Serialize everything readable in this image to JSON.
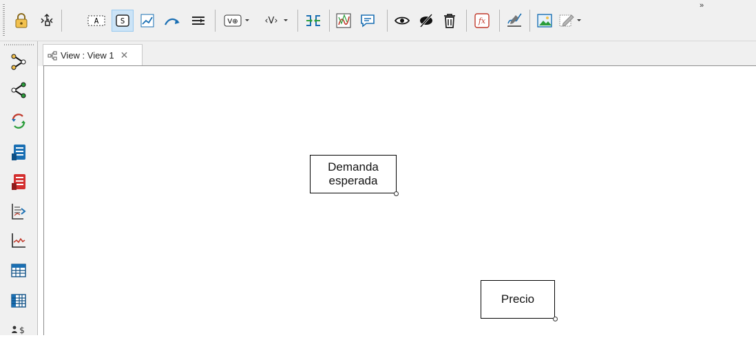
{
  "toolbar": {
    "items": [
      {
        "icon": "lock-icon"
      },
      {
        "icon": "pan-move-icon"
      },
      {
        "icon": "text-box-a-icon",
        "text": "A"
      },
      {
        "icon": "stock-s-icon",
        "text": "S",
        "active": true
      },
      {
        "icon": "line-chart-icon"
      },
      {
        "icon": "connector-arrow-icon"
      },
      {
        "icon": "align-lines-icon"
      },
      {
        "icon": "variable-add-icon",
        "text": "V⊕"
      },
      {
        "icon": "variable-dropdown-icon",
        "text": "‹V›"
      },
      {
        "icon": "merge-arrows-icon"
      },
      {
        "icon": "graph-icon"
      },
      {
        "icon": "comment-icon"
      },
      {
        "icon": "show-eye-icon"
      },
      {
        "icon": "hide-eye-icon"
      },
      {
        "icon": "trash-icon"
      },
      {
        "icon": "function-fx-icon",
        "text": "fx"
      },
      {
        "icon": "signature-icon"
      },
      {
        "icon": "image-icon"
      },
      {
        "icon": "edit-shape-icon"
      }
    ],
    "overflow": "»"
  },
  "sidebar": {
    "items": [
      {
        "icon": "tree-expand-icon"
      },
      {
        "icon": "share-nodes-icon"
      },
      {
        "icon": "cycle-icon"
      },
      {
        "icon": "document-blue-icon"
      },
      {
        "icon": "document-red-icon"
      },
      {
        "icon": "list-chart-icon"
      },
      {
        "icon": "line-graph-icon"
      },
      {
        "icon": "table-icon"
      },
      {
        "icon": "table-grid-icon"
      },
      {
        "icon": "person-dollar-icon"
      }
    ]
  },
  "tab": {
    "label": "View : View 1",
    "close": "✕"
  },
  "canvas": {
    "nodes": [
      {
        "label": "Demanda esperada"
      },
      {
        "label": "Precio"
      }
    ]
  },
  "colors": {
    "accent": "#cce4f7",
    "background": "#f0f0f0"
  }
}
